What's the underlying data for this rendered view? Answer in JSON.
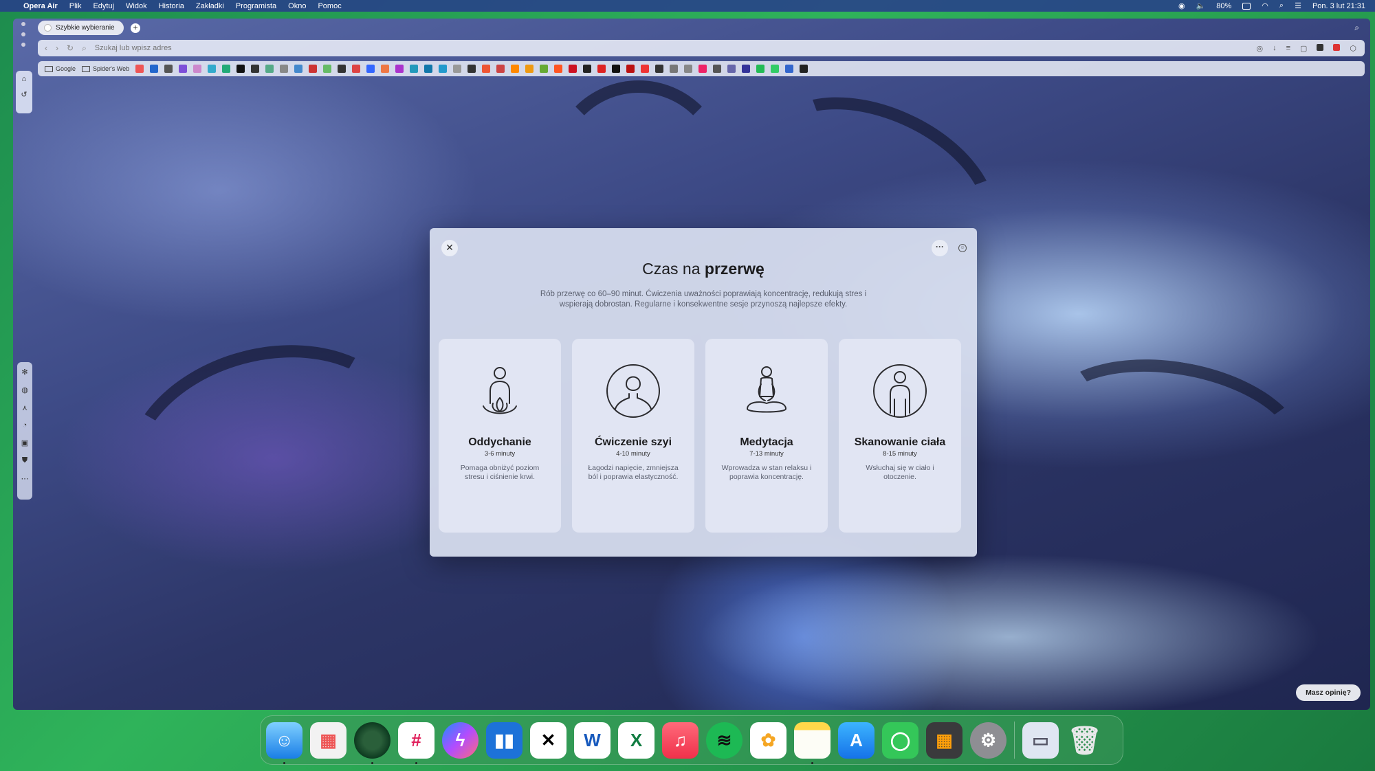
{
  "menubar": {
    "app_name": "Opera Air",
    "items": [
      "Plik",
      "Edytuj",
      "Widok",
      "Historia",
      "Zakładki",
      "Programista",
      "Okno",
      "Pomoc"
    ],
    "battery": "80%",
    "clock": "Pon. 3 lut  21:31"
  },
  "browser": {
    "tab_title": "Szybkie wybieranie",
    "add_tab": "+",
    "address_placeholder": "Szukaj lub wpisz adres",
    "bookmarks": [
      "Google",
      "Spider's Web"
    ],
    "feedback_button": "Masz opinię?"
  },
  "modal": {
    "title_plain": "Czas na",
    "title_bold": "przerwę",
    "description": "Rób przerwę co 60–90 minut. Ćwiczenia uważności poprawiają koncentrację, redukują stres i wspierają dobrostan. Regularne i konsekwentne sesje przynoszą najlepsze efekty.",
    "close_label": "✕",
    "more_label": "···",
    "cards": [
      {
        "title": "Oddychanie",
        "duration": "3-6 minuty",
        "description": "Pomaga obniżyć poziom stresu i ciśnienie krwi.",
        "icon": "breathing-figure-icon"
      },
      {
        "title": "Ćwiczenie szyi",
        "duration": "4-10 minuty",
        "description": "Łagodzi napięcie, zmniejsza ból i poprawia elastyczność.",
        "icon": "neck-figure-icon"
      },
      {
        "title": "Medytacja",
        "duration": "7-13 minuty",
        "description": "Wprowadza w stan relaksu i poprawia koncentrację.",
        "icon": "meditation-figure-icon"
      },
      {
        "title": "Skanowanie ciała",
        "duration": "8-15 minuty",
        "description": "Wsłuchaj się w ciało i otoczenie.",
        "icon": "body-scan-figure-icon"
      }
    ]
  },
  "dock": {
    "apps": [
      "finder",
      "launchpad",
      "opera-air",
      "slack",
      "messenger",
      "trello",
      "capcut",
      "word",
      "excel",
      "music",
      "spotify",
      "photos",
      "notes",
      "app-store",
      "messages",
      "calculator",
      "system-settings",
      "preview",
      "trash"
    ],
    "app_glyphs": {
      "word": "W",
      "excel": "X",
      "trello": "▮▮"
    }
  },
  "colors": {
    "desktop_green": "#2fb35a",
    "modal_bg": "#d7ddee",
    "card_bg": "#e4e8f4",
    "menubar": "#283c8c"
  }
}
